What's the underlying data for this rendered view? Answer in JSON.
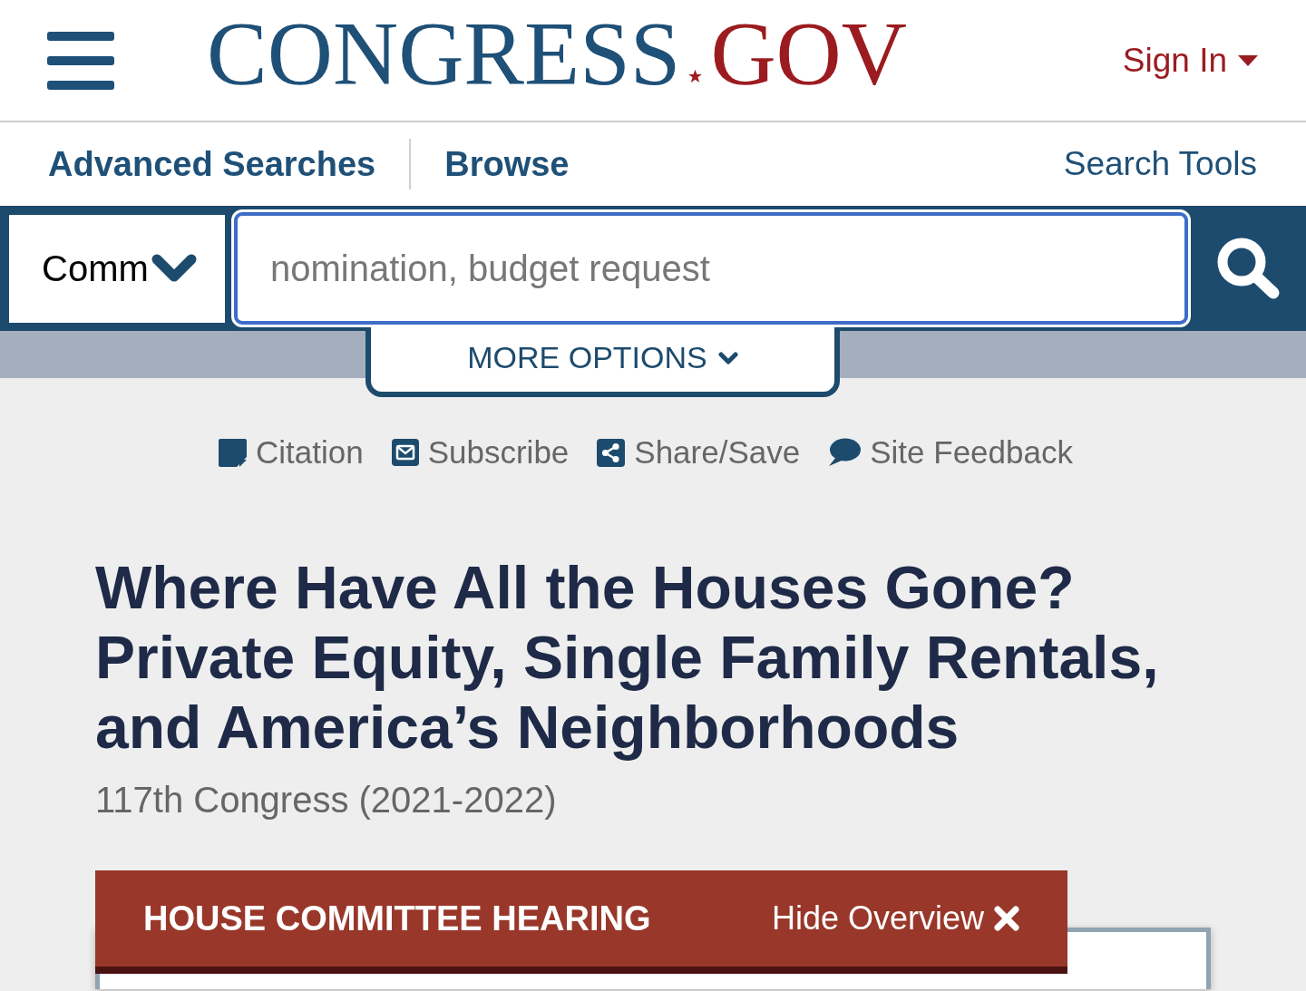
{
  "header": {
    "logo": {
      "name": "CONGRESS",
      "suffix": "GOV"
    },
    "sign_in": "Sign In"
  },
  "nav": {
    "links": [
      {
        "label": "Advanced Searches"
      },
      {
        "label": "Browse"
      }
    ],
    "search_tools": "Search Tools"
  },
  "search": {
    "scope": "Comm",
    "placeholder": "nomination, budget request",
    "more_options": "MORE OPTIONS"
  },
  "actions": [
    {
      "kind": "citation",
      "label": "Citation"
    },
    {
      "kind": "subscribe",
      "label": "Subscribe"
    },
    {
      "kind": "share",
      "label": "Share/Save"
    },
    {
      "kind": "feedback",
      "label": "Site Feedback"
    }
  ],
  "title": "Where Have All the Houses Gone? Private Equity, Single Family Rentals, and America’s Neighborhoods",
  "congress": "117th Congress (2021-2022)",
  "overview": {
    "type": "HOUSE COMMITTEE HEARING",
    "toggle": "Hide Overview"
  }
}
